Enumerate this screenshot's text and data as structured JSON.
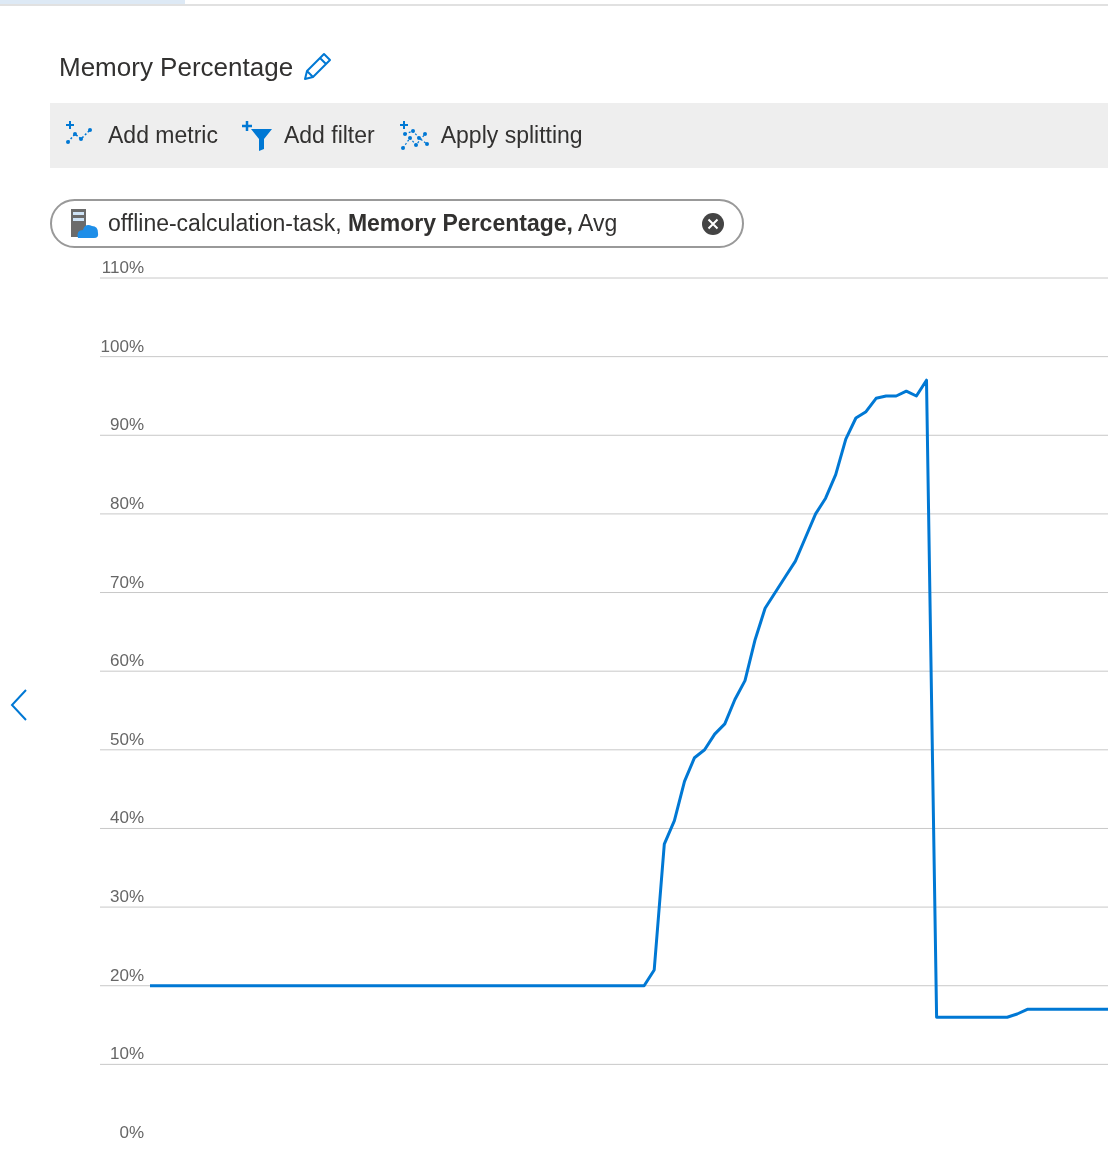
{
  "header": {
    "title": "Memory Percentage"
  },
  "toolbar": {
    "buttons": [
      {
        "kind": "metric",
        "label": "Add metric"
      },
      {
        "kind": "filter",
        "label": "Add filter"
      },
      {
        "kind": "split",
        "label": "Apply splitting"
      }
    ]
  },
  "metric_pill": {
    "resource": "offline-calculation-task,",
    "metric": "Memory Percentage,",
    "aggregation": "Avg"
  },
  "chart": {
    "chart_data": {
      "type": "line",
      "yticks": [
        {
          "value": 0,
          "label": "0%"
        },
        {
          "value": 10,
          "label": "10%"
        },
        {
          "value": 20,
          "label": "20%"
        },
        {
          "value": 30,
          "label": "30%"
        },
        {
          "value": 40,
          "label": "40%"
        },
        {
          "value": 50,
          "label": "50%"
        },
        {
          "value": 60,
          "label": "60%"
        },
        {
          "value": 70,
          "label": "70%"
        },
        {
          "value": 80,
          "label": "80%"
        },
        {
          "value": 90,
          "label": "90%"
        },
        {
          "value": 100,
          "label": "100%"
        },
        {
          "value": 110,
          "label": "110%"
        }
      ],
      "ylim": [
        0,
        110
      ],
      "grid": true,
      "categories": [
        null,
        null,
        null,
        null,
        null,
        null,
        null,
        null,
        null,
        null,
        null,
        null,
        null,
        null,
        null,
        null,
        null,
        null,
        null,
        null,
        null,
        null,
        null,
        null,
        null,
        null,
        null,
        null,
        null,
        null,
        null,
        null,
        null,
        null,
        null,
        null,
        null,
        null,
        null,
        null,
        null,
        null,
        null,
        null,
        null,
        null,
        null,
        null,
        null,
        null,
        null,
        null,
        null,
        null,
        null,
        null,
        null,
        null,
        null,
        null,
        null,
        null,
        null,
        null,
        null,
        null,
        null,
        null,
        null,
        null,
        null,
        null,
        null,
        null,
        null,
        null,
        null,
        null,
        null,
        null,
        null,
        null,
        null,
        null,
        null,
        null,
        null,
        null,
        null,
        null,
        null,
        null,
        null,
        null,
        null,
        null
      ],
      "series": [
        {
          "color": "#0078d4",
          "values": [
            20,
            20,
            20,
            20,
            20,
            20,
            20,
            20,
            20,
            20,
            20,
            20,
            20,
            20,
            20,
            20,
            20,
            20,
            20,
            20,
            20,
            20,
            20,
            20,
            20,
            20,
            20,
            20,
            20,
            20,
            20,
            20,
            20,
            20,
            20,
            20,
            20,
            20,
            20,
            20,
            20,
            20,
            20,
            20,
            20,
            20,
            20,
            20,
            20,
            20,
            22,
            38,
            41,
            46,
            49,
            50,
            52,
            53.3,
            56.4,
            58.8,
            64,
            68,
            70,
            72,
            74,
            77,
            80,
            82,
            85,
            89.5,
            92.2,
            93,
            94.7,
            95,
            95,
            95.6,
            95,
            97,
            16,
            16,
            16,
            16,
            16,
            16,
            16,
            16,
            16.4,
            17,
            17,
            17,
            17,
            17,
            17,
            17,
            17,
            17
          ]
        }
      ]
    }
  }
}
